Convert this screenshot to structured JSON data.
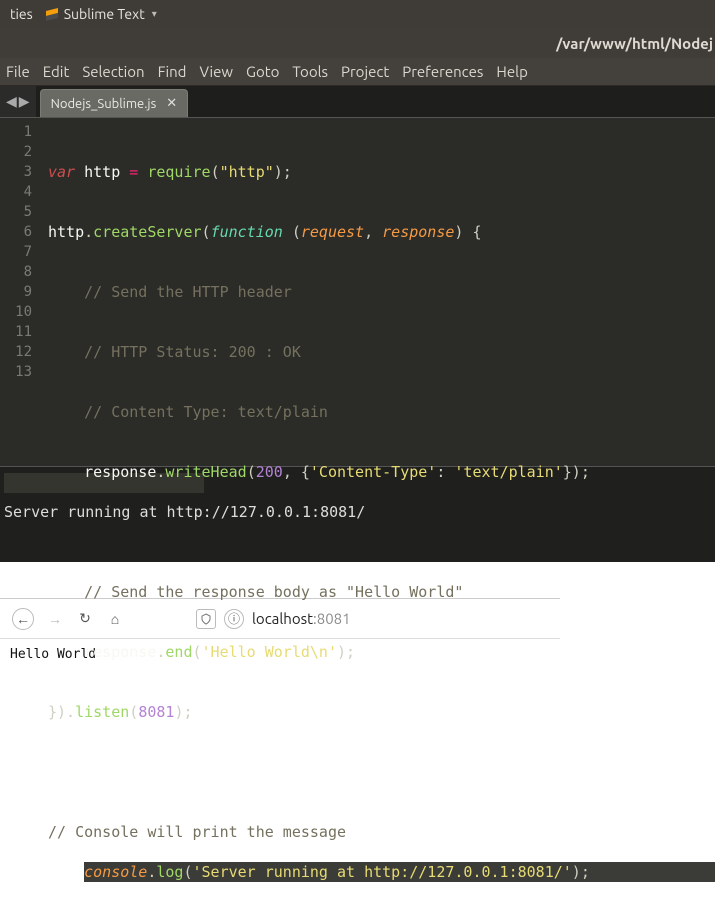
{
  "top_panel": {
    "left_text": "ties",
    "app_name": "Sublime Text"
  },
  "window": {
    "title_path": "/var/www/html/Nodej"
  },
  "menu": [
    "File",
    "Edit",
    "Selection",
    "Find",
    "View",
    "Goto",
    "Tools",
    "Project",
    "Preferences",
    "Help"
  ],
  "tab": {
    "name": "Nodejs_Sublime.js"
  },
  "line_numbers": [
    "1",
    "2",
    "3",
    "4",
    "5",
    "6",
    "7",
    "8",
    "9",
    "10",
    "11",
    "12",
    "13"
  ],
  "code": {
    "l1": {
      "kw": "var",
      "id": "http",
      "eq": "=",
      "fn": "require",
      "open": "(",
      "str": "\"http\"",
      "close": ");"
    },
    "l2": {
      "id": "http",
      "dot": ".",
      "fn": "createServer",
      "open": "(",
      "kw": "function",
      "t": " (",
      "p1": "request",
      "c": ", ",
      "p2": "response",
      "close": ") {"
    },
    "l3": "    // Send the HTTP header",
    "l4": "    // HTTP Status: 200 : OK",
    "l5": "    // Content Type: text/plain",
    "l6": {
      "indent": "    ",
      "id": "response",
      "dot": ".",
      "fn": "writeHead",
      "open": "(",
      "num": "200",
      "c": ", {",
      "k": "'Content-Type'",
      "colon": ": ",
      "v": "'text/plain'",
      "close": "});"
    },
    "l8": "    // Send the response body as \"Hello World\"",
    "l9": {
      "indent": "    ",
      "id": "response",
      "dot": ".",
      "fn": "end",
      "open": "(",
      "str": "'Hello World\\n'",
      "close": ");"
    },
    "l10": {
      "t": "}).",
      "fn": "listen",
      "open": "(",
      "num": "8081",
      "close": ");"
    },
    "l12": "// Console will print the message",
    "l13": {
      "id": "console",
      "dot": ".",
      "fn": "log",
      "open": "(",
      "str": "'Server running at http://127.0.0.1:8081/'",
      "close": ");"
    }
  },
  "console_output": "Server running at http://127.0.0.1:8081/",
  "browser": {
    "host": "localhost",
    "port": ":8081",
    "body": "Hello World"
  }
}
